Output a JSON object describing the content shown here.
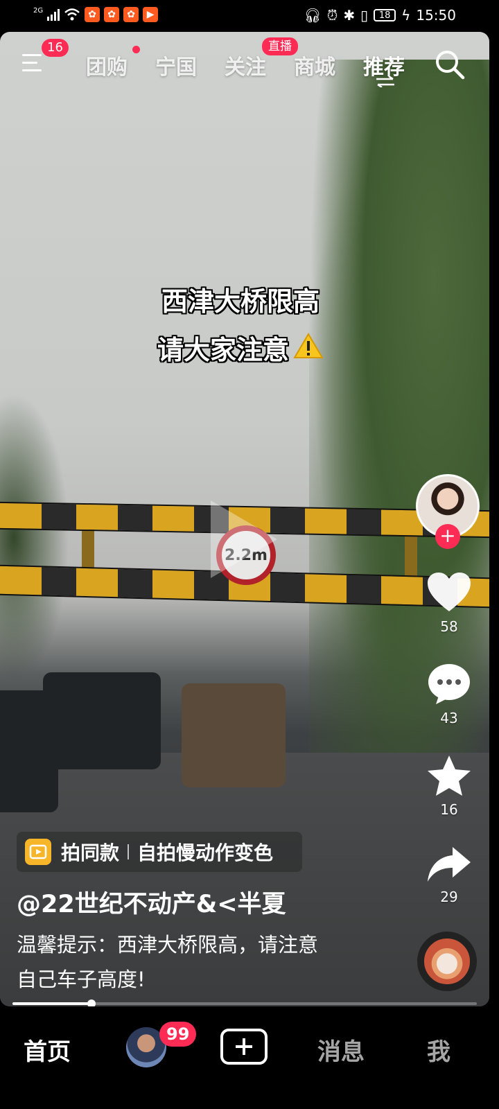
{
  "status_bar": {
    "network": "2G",
    "time": "15:50",
    "battery": "18"
  },
  "top_nav": {
    "menu_badge": "16",
    "tabs": [
      {
        "label": "团购"
      },
      {
        "label": "宁国"
      },
      {
        "label": "关注"
      },
      {
        "label": "商城"
      },
      {
        "label": "推荐"
      }
    ],
    "live_badge": "直播",
    "active_tab": "推荐"
  },
  "video": {
    "caption_line1": "西津大桥限高",
    "caption_line2": "请大家注意",
    "sign_text": "2.2m"
  },
  "actions": {
    "likes": "58",
    "comments": "43",
    "favorites": "16",
    "shares": "29"
  },
  "info": {
    "same_style_label": "拍同款",
    "same_style_effect": "自拍慢动作变色",
    "author": "@22世纪不动产&<半夏",
    "description_line1": "温馨提示：西津大桥限高，请注意",
    "description_line2": "自己车子高度!"
  },
  "progress": 0.17,
  "tab_bar": {
    "home": "首页",
    "friends_badge": "99",
    "messages": "消息",
    "me": "我"
  },
  "colors": {
    "accent": "#fe2c55",
    "same_style_icon": "#f7b52a"
  }
}
